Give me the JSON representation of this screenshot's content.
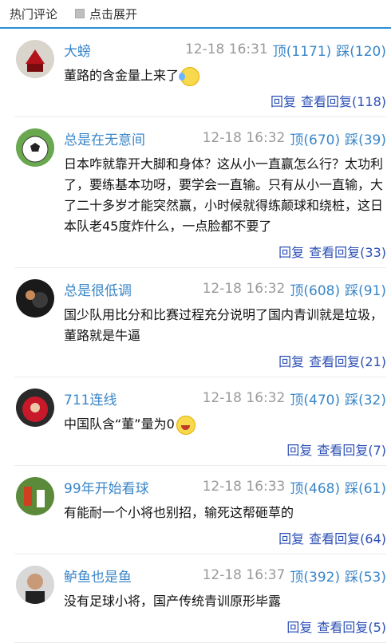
{
  "header": {
    "title": "热门评论",
    "expand_label": "点击展开"
  },
  "comments": [
    {
      "user": "大螃",
      "time": "12-18 16:31",
      "up": "顶(1171)",
      "down": "踩(120)",
      "text": "董路的含金量上来了",
      "reply": "回复",
      "view_replies": "查看回复(118)"
    },
    {
      "user": "总是在无意间",
      "time": "12-18 16:32",
      "up": "顶(670)",
      "down": "踩(39)",
      "text": "日本咋就靠开大脚和身体？这从小一直赢怎么行？太功利了，要练基本功呀，要学会一直输。只有从小一直输，大了二十多岁才能突然赢，小时候就得练颠球和绕桩，这日本队老45度炸什么，一点脸都不要了",
      "reply": "回复",
      "view_replies": "查看回复(33)"
    },
    {
      "user": "总是很低调",
      "time": "12-18 16:32",
      "up": "顶(608)",
      "down": "踩(91)",
      "text": "国少队用比分和比赛过程充分说明了国内青训就是垃圾，董路就是牛逼",
      "reply": "回复",
      "view_replies": "查看回复(21)"
    },
    {
      "user": "711连线",
      "time": "12-18 16:32",
      "up": "顶(470)",
      "down": "踩(32)",
      "text": "中国队含“董”量为0",
      "reply": "回复",
      "view_replies": "查看回复(7)"
    },
    {
      "user": "99年开始看球",
      "time": "12-18 16:33",
      "up": "顶(468)",
      "down": "踩(61)",
      "text": "有能耐一个小将也别招，输死这帮砸草的",
      "reply": "回复",
      "view_replies": "查看回复(64)"
    },
    {
      "user": "鲈鱼也是鱼",
      "time": "12-18 16:37",
      "up": "顶(392)",
      "down": "踩(53)",
      "text": "没有足球小将，国产传统青训原形毕露",
      "reply": "回复",
      "view_replies": "查看回复(5)"
    }
  ]
}
